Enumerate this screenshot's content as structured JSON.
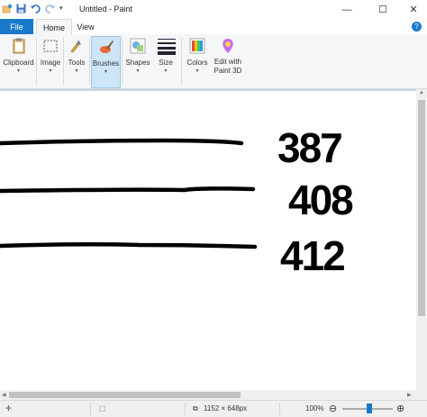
{
  "window": {
    "title": "Untitled - Paint",
    "minimize": "—",
    "maximize": "☐",
    "close": "✕"
  },
  "tabs": {
    "file": "File",
    "home": "Home",
    "view": "View"
  },
  "ribbon": {
    "groups": [
      {
        "label": "Clipboard",
        "icon": "clipboard-icon"
      },
      {
        "label": "Image",
        "icon": "image-select-icon"
      },
      {
        "label": "Tools",
        "icon": "tools-icon"
      },
      {
        "label": "Brushes",
        "icon": "brush-icon"
      },
      {
        "label": "Shapes",
        "icon": "shapes-icon"
      },
      {
        "label": "Size",
        "icon": "size-icon"
      },
      {
        "label": "Colors",
        "icon": "palette-icon"
      },
      {
        "label_line1": "Edit with",
        "label_line2": "Paint 3D",
        "icon": "paint3d-icon"
      }
    ]
  },
  "canvas": {
    "numbers": [
      "387",
      "408",
      "412"
    ]
  },
  "status": {
    "dimensions": "1152 × 648px",
    "zoom": "100%"
  },
  "colors": {
    "accent": "#1979ca",
    "ribbon_bg": "#f5f6f7",
    "canvas_bg": "#c9d3e2"
  }
}
